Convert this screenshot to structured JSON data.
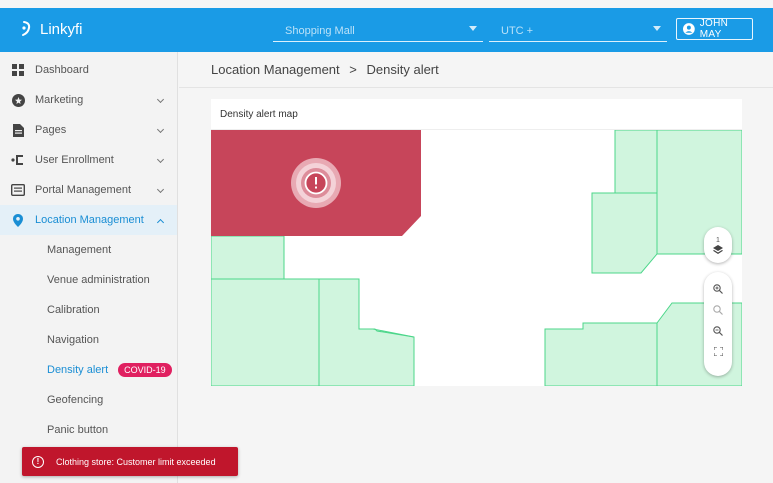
{
  "app": {
    "brand": "Linkyfi"
  },
  "header": {
    "venue_select": {
      "value": "Shopping Mall"
    },
    "timezone_select": {
      "value": "UTC +"
    },
    "user": {
      "name": "JOHN MAY"
    }
  },
  "sidebar": {
    "items": [
      {
        "label": "Dashboard",
        "icon": "dashboard-icon"
      },
      {
        "label": "Marketing",
        "icon": "marketing-icon"
      },
      {
        "label": "Pages",
        "icon": "pages-icon"
      },
      {
        "label": "User Enrollment",
        "icon": "user-enrollment-icon"
      },
      {
        "label": "Portal Management",
        "icon": "portal-icon"
      },
      {
        "label": "Location Management",
        "icon": "location-pin-icon"
      }
    ],
    "sub_items": [
      {
        "label": "Management"
      },
      {
        "label": "Venue administration"
      },
      {
        "label": "Calibration"
      },
      {
        "label": "Navigation"
      },
      {
        "label": "Density alert",
        "badge": "COVID-19"
      },
      {
        "label": "Geofencing"
      },
      {
        "label": "Panic button"
      }
    ]
  },
  "breadcrumb": {
    "parent": "Location Management",
    "separator": ">",
    "current": "Density alert"
  },
  "card": {
    "title": "Density alert map"
  },
  "map": {
    "floor_number": "1"
  },
  "toast": {
    "message": "Clothing store: Customer limit exceeded"
  },
  "colors": {
    "primary": "#1a9be6",
    "alert_zone": "#c7455a",
    "zone_fill": "#d0f5de",
    "zone_stroke": "#4cd68a",
    "badge": "#e02060",
    "toast": "#c0162c"
  }
}
